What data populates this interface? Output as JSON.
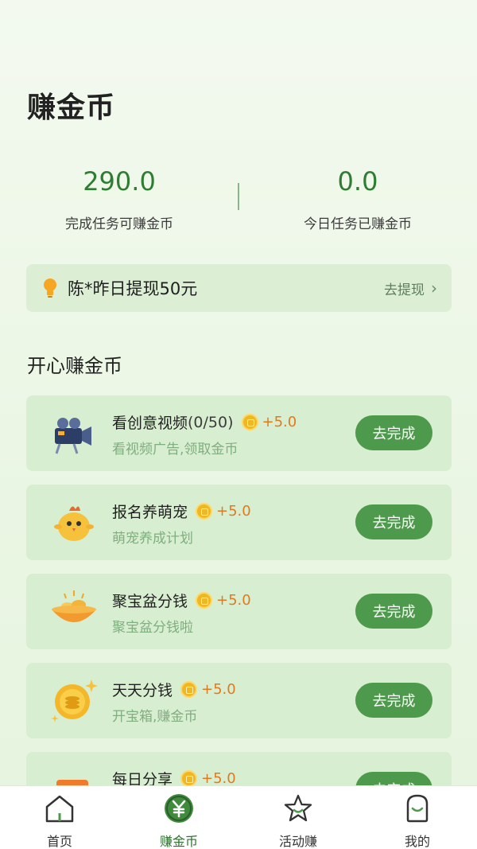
{
  "status_bar": {
    "left": "",
    "right": ""
  },
  "page_title": "赚金币",
  "stats": {
    "left": {
      "value": "290.0",
      "label": "完成任务可赚金币"
    },
    "right": {
      "value": "0.0",
      "label": "今日任务已赚金币"
    }
  },
  "notice": {
    "text": "陈*昨日提现50元",
    "link": "去提现",
    "chevron": "›"
  },
  "section_title": "开心赚金币",
  "tasks": [
    {
      "icon": "video-camera-icon",
      "title": "看创意视频",
      "progress": "(0/50)",
      "reward": "+5.0",
      "subtitle": "看视频广告,领取金币",
      "button": "去完成"
    },
    {
      "icon": "chick-pet-icon",
      "title": "报名养萌宠",
      "progress": "",
      "reward": "+5.0",
      "subtitle": "萌宠养成计划",
      "button": "去完成"
    },
    {
      "icon": "treasure-bowl-icon",
      "title": "聚宝盆分钱",
      "progress": "",
      "reward": "+5.0",
      "subtitle": "聚宝盆分钱啦",
      "button": "去完成"
    },
    {
      "icon": "gold-coin-icon",
      "title": "天天分钱",
      "progress": "",
      "reward": "+5.0",
      "subtitle": "开宝箱,赚金币",
      "button": "去完成"
    },
    {
      "icon": "share-envelope-icon",
      "title": "每日分享",
      "progress": "",
      "reward": "+5.0",
      "subtitle": "",
      "button": "去完成"
    }
  ],
  "tabbar": [
    {
      "label": "首页",
      "icon": "home-icon"
    },
    {
      "label": "赚金币",
      "icon": "yuan-coin-icon",
      "active": true
    },
    {
      "label": "活动赚",
      "icon": "star-icon"
    },
    {
      "label": "我的",
      "icon": "profile-bag-icon"
    }
  ],
  "colors": {
    "accent": "#4e9a4c",
    "reward": "#e07a1f",
    "value": "#2e7d32"
  }
}
